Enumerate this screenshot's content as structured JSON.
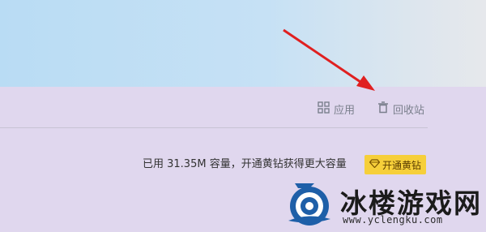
{
  "toolbar": {
    "apps": {
      "label": "应用",
      "icon": "grid-icon"
    },
    "recycle": {
      "label": "回收站",
      "icon": "trash-icon"
    }
  },
  "storage": {
    "text": "已用 31.35M 容量，开通黄钻获得更大容量",
    "upgrade_label": "开通黄钻",
    "upgrade_icon": "diamond-icon"
  },
  "watermark": {
    "title": "冰楼游戏网",
    "url": "www.yclengku.com"
  },
  "colors": {
    "banner": "#c0def5",
    "panel": "#e0d7ee",
    "upgrade_bg": "#f6cf3a",
    "arrow": "#e02020"
  }
}
